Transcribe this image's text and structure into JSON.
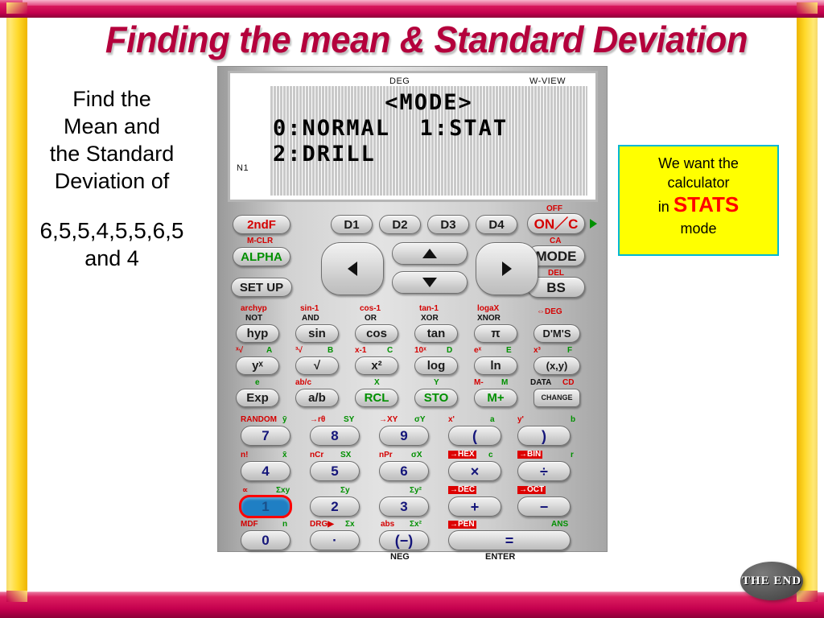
{
  "slide": {
    "title": "Finding  the mean & Standard Deviation",
    "accent_crimson": "#b4003c",
    "accent_gold": "#ffd92b",
    "callout_yellow": "#ffff00",
    "callout_border": "#00b7d4",
    "stats_red": "#ff0000"
  },
  "left_text": {
    "line1": "Find the",
    "line2": "Mean and",
    "line3": "the Standard",
    "line4": "Deviation of",
    "data_line1": "6,5,5,4,5,5,6,5",
    "data_line2": "and 4"
  },
  "callout": {
    "line1": "We want the",
    "line2": "calculator",
    "in_word": "in ",
    "stats_word": "STATS",
    "line4": "mode"
  },
  "calculator": {
    "lcd": {
      "deg": "DEG",
      "wview": "W-VIEW",
      "n1": "N1",
      "row1": "<MODE>",
      "row2": "0:NORMAL  1:STAT",
      "row3": "2:DRILL"
    },
    "keys": {
      "secondf": "2ndF",
      "secondf_sub": "M-CLR",
      "alpha": "ALPHA",
      "setup": "SET UP",
      "d1": "D1",
      "d2": "D2",
      "d3": "D3",
      "d4": "D4",
      "on_c": "ON／C",
      "on_c_top": "OFF",
      "on_c_sub": "CA",
      "mode": "MODE",
      "mode_sub": "DEL",
      "bs": "BS",
      "hyp": "hyp",
      "hyp_top_r": "archyp",
      "hyp_top_k": "NOT",
      "sin": "sin",
      "sin_top_r": "sin-1",
      "sin_top_k": "AND",
      "cos": "cos",
      "cos_top_r": "cos-1",
      "cos_top_k": "OR",
      "tan": "tan",
      "tan_top_r": "tan-1",
      "tan_top_k": "XOR",
      "pi": "π",
      "pi_top_r": "logaX",
      "pi_top_k": "XNOR",
      "dms": "D'M'S",
      "dms_top_r": "⇔DEG",
      "ypowx": "yˣ",
      "ypowx_top_r": "ˣ√",
      "ypowx_top_g": "A",
      "sqrt": "√",
      "sqrt_top_r": "³√",
      "sqrt_top_g": "B",
      "xsq": "x²",
      "xsq_top_r": "x-1",
      "xsq_top_g": "C",
      "log": "log",
      "log_top_r": "10ˣ",
      "log_top_g": "D",
      "ln": "ln",
      "ln_top_r": "eˣ",
      "ln_top_g": "E",
      "xy": "(x,y)",
      "xy_top_r": "x³",
      "xy_top_g": "F",
      "exp": "Exp",
      "exp_top_g": "e",
      "ab": "a/b",
      "ab_top_r": "ab/c",
      "rcl": "RCL",
      "rcl_top_g": "X",
      "sto": "STO",
      "sto_top_g": "Y",
      "mplus": "M+",
      "mplus_top_r": "M-",
      "mplus_top_g": "M",
      "change": "CHANGE",
      "change_top_k": "DATA",
      "change_top_r": "CD",
      "k7": "7",
      "k7_top_r": "RANDOM",
      "k7_top_g": "ȳ",
      "k8": "8",
      "k8_top_r": "→rθ",
      "k8_top_g": "SY",
      "k9": "9",
      "k9_top_r": "→XY",
      "k9_top_g": "σY",
      "lparen": "(",
      "lparen_top_r": "x'",
      "lparen_top_g": "a",
      "rparen": ")",
      "rparen_top_r": "y'",
      "rparen_top_g": "b",
      "k4": "4",
      "k4_top_r": "n!",
      "k4_top_g": "x̄",
      "k5": "5",
      "k5_top_r": "nCr",
      "k5_top_g": "SX",
      "k6": "6",
      "k6_top_r": "nPr",
      "k6_top_g": "σX",
      "mult": "×",
      "mult_top_w": "→HEX",
      "mult_top_g": "c",
      "div": "÷",
      "div_top_w": "→BIN",
      "div_top_g": "r",
      "k1": "1",
      "k1_top_r": "∝",
      "k1_top_g": "Σxy",
      "k2": "2",
      "k2_top_g": "Σy",
      "k3": "3",
      "k3_top_g": "Σy²",
      "plus": "+",
      "plus_top_w": "→DEC",
      "minus": "−",
      "minus_top_w": "→OCT",
      "k0": "0",
      "k0_top_r": "MDF",
      "k0_top_g": "n",
      "dot": "·",
      "dot_top_r": "DRG▶",
      "dot_top_g": "Σx",
      "neg": "(−)",
      "neg_top_r": "abs",
      "neg_top_g": "Σx²",
      "neg_sub": "NEG",
      "equals": "=",
      "equals_top_w": "→PEN",
      "equals_top_g": "ANS",
      "equals_sub": "ENTER"
    },
    "selected_key": "1"
  },
  "the_end": {
    "label": "THE END"
  }
}
